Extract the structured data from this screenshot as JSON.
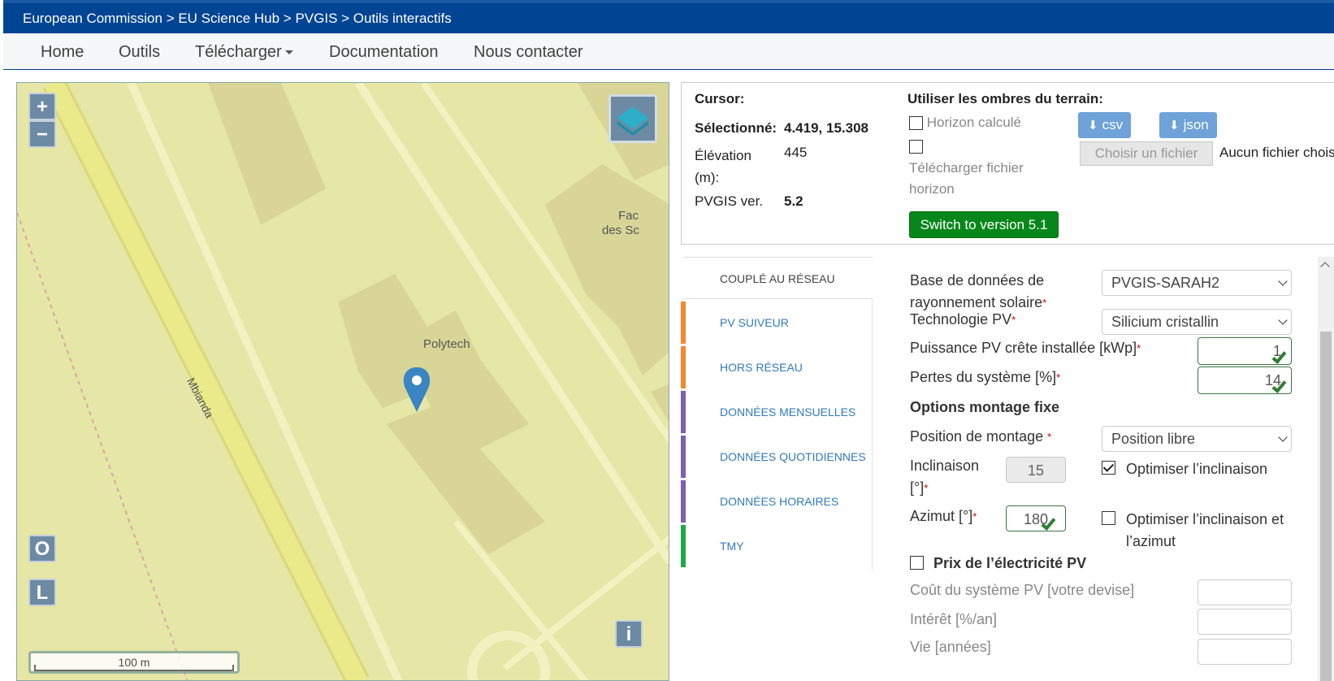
{
  "breadcrumb": "European Commission > EU Science Hub > PVGIS > Outils interactifs",
  "nav": {
    "home": "Home",
    "tools": "Outils",
    "download": "Télécharger",
    "docs": "Documentation",
    "contact": "Nous contacter"
  },
  "map": {
    "zoom_in": "+",
    "zoom_out": "−",
    "btn_o": "O",
    "btn_l": "L",
    "info_btn": "i",
    "scale": "100 m",
    "marker_label": "Polytech",
    "street_label": "Mbianda",
    "edge_label_1": "Fac",
    "edge_label_2": "des Sc",
    "colors": {
      "land": "#e6e6a6",
      "building": "#d8d597",
      "road": "#f3f1c0",
      "major_road": "#eaea8a",
      "marker": "#3a85c2"
    }
  },
  "info": {
    "cursor_label": "Cursor:",
    "selected_label": "Sélectionné:",
    "selected_value": "4.419, 15.308",
    "elevation_label": "Élévation (m):",
    "elevation_value": "445",
    "version_label": "PVGIS ver.",
    "version_value": "5.2",
    "shadows_title": "Utiliser les ombres du terrain:",
    "horizon_calc": "Horizon calculé",
    "upload_horizon": "Télécharger fichier horizon",
    "csv": "csv",
    "json": "json",
    "choose_file": "Choisir un fichier",
    "no_file": "Aucun fichier choisi",
    "switch_btn": "Switch to version 5.1",
    "accent_green": "#07871a",
    "accent_blue": "#4a8ccf"
  },
  "tabs": [
    {
      "label": "COUPLÉ AU RÉSEAU",
      "color": "#ffffff"
    },
    {
      "label": "PV SUIVEUR",
      "color": "#f5892f"
    },
    {
      "label": "HORS RÉSEAU",
      "color": "#f5892f"
    },
    {
      "label": "DONNÉES MENSUELLES",
      "color": "#7b5fb8"
    },
    {
      "label": "DONNÉES QUOTIDIENNES",
      "color": "#7b5fb8"
    },
    {
      "label": "DONNÉES HORAIRES",
      "color": "#7b5fb8"
    },
    {
      "label": "TMY",
      "color": "#1ea84a"
    }
  ],
  "form": {
    "db_label": "Base de données de rayonnement solaire",
    "db_value": "PVGIS-SARAH2",
    "tech_label": "Technologie PV",
    "tech_value": "Silicium cristallin",
    "power_label": "Puissance PV crête installée [kWp]",
    "power_value": "1",
    "loss_label": "Pertes du système [%]",
    "loss_value": "14",
    "fixed_title": "Options montage fixe",
    "position_label": "Position de montage",
    "position_value": "Position libre",
    "slope_label": "Inclinaison [°]",
    "slope_value": "15",
    "opt_slope": "Optimiser l’inclinaison",
    "azimuth_label": "Azimut [°]",
    "azimuth_value": "180",
    "opt_both": "Optimiser l’inclinaison et l’azimut",
    "price_title": "Prix de l’électricité PV",
    "cost_label": "Coût du système PV [votre devise]",
    "interest_label": "Intérêt [%/an]",
    "life_label": "Vie [années]",
    "required_mark": "*"
  }
}
